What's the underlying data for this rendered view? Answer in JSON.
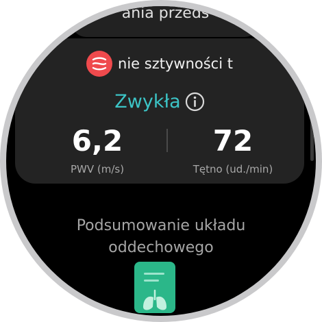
{
  "top_card": {
    "text": "ania przeds"
  },
  "main_card": {
    "title": "nie sztywności t",
    "icon": "heart-wave-icon",
    "status": "Zwykła",
    "status_icon": "info-icon",
    "metrics": [
      {
        "value": "6,2",
        "label": "PWV (m/s)"
      },
      {
        "value": "72",
        "label": "Tętno (ud./min)"
      }
    ]
  },
  "section": {
    "title_line1": "Podsumowanie układu",
    "title_line2": "oddechowego"
  },
  "lung_icon": "lungs-report-icon",
  "colors": {
    "accent": "#3cc4c6",
    "app_icon": "#ef4a4d",
    "card_bg": "#232323",
    "respiratory": "#2bb789"
  }
}
